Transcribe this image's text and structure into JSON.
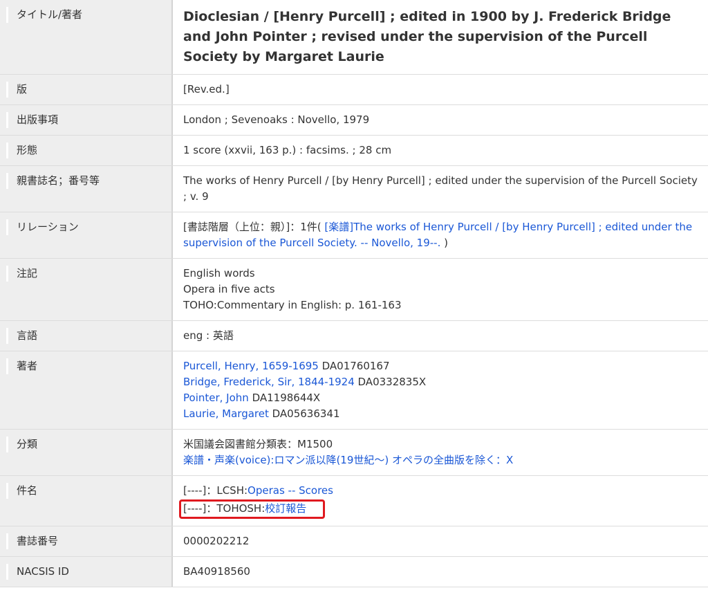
{
  "rows": {
    "title": {
      "label": "タイトル/著者",
      "value": "Dioclesian / [Henry Purcell] ; edited in 1900 by J. Frederick Bridge and John Pointer ; revised under the supervision of the Purcell Society by Margaret Laurie"
    },
    "edition": {
      "label": "版",
      "value": "[Rev.ed.]"
    },
    "publication": {
      "label": "出版事項",
      "value": "London ; Sevenoaks : Novello, 1979"
    },
    "physical": {
      "label": "形態",
      "value": "1 score (xxvii, 163 p.) : facsims. ; 28 cm"
    },
    "series": {
      "label": "親書誌名；番号等",
      "value": "The works of Henry Purcell / [by Henry Purcell] ; edited under the supervision of the Purcell Society ; v. 9"
    },
    "relation": {
      "label": "リレーション",
      "prefix": "[書誌階層（上位：親）]：1件( ",
      "link": "[楽譜]The works of Henry Purcell / [by Henry Purcell] ; edited under the supervision of the Purcell Society. -- Novello, 19--.",
      "suffix": " )"
    },
    "notes": {
      "label": "注記",
      "lines": [
        "English words",
        "Opera in five acts",
        "TOHO:Commentary in English: p. 161-163"
      ]
    },
    "language": {
      "label": "言語",
      "value": "eng : 英語"
    },
    "authors": {
      "label": "著者",
      "items": [
        {
          "name": "Purcell, Henry, 1659-1695",
          "id": " DA01760167"
        },
        {
          "name": "Bridge, Frederick, Sir, 1844-1924",
          "id": " DA0332835X"
        },
        {
          "name": "Pointer, John",
          "id": " DA1198644X"
        },
        {
          "name": "Laurie, Margaret",
          "id": " DA05636341"
        }
      ]
    },
    "classification": {
      "label": "分類",
      "line1": "米国議会図書館分類表：M1500",
      "line2_link": "楽譜・声楽(voice):ロマン派以降(19世紀～) オペラの全曲版を除く：X"
    },
    "subjects": {
      "label": "件名",
      "item1_prefix": "[----]：LCSH:",
      "item1_link": "Operas -- Scores",
      "item2_prefix": "[----]：TOHOSH:",
      "item2_link": "校訂報告"
    },
    "bib_id": {
      "label": "書誌番号",
      "value": "0000202212"
    },
    "nacsis": {
      "label": "NACSIS ID",
      "value": "BA40918560"
    }
  },
  "colors": {
    "link": "#1a57d6",
    "highlight": "#e0191f",
    "label_bg": "#eeeeee"
  }
}
